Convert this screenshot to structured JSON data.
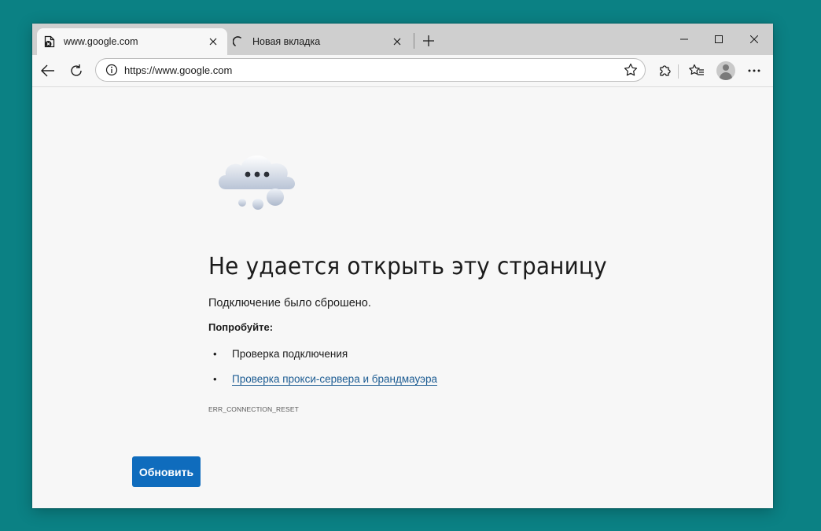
{
  "tabs": [
    {
      "title": "www.google.com",
      "active": true,
      "icon": "error-page-icon"
    },
    {
      "title": "Новая вкладка",
      "active": false,
      "icon": "loading-spinner-icon"
    }
  ],
  "address_bar": {
    "url": "https://www.google.com"
  },
  "error_page": {
    "title": "Не удается открыть эту страницу",
    "subtitle": "Подключение было сброшено.",
    "try_label": "Попробуйте:",
    "suggestions": [
      "Проверка подключения",
      "Проверка прокси-сервера и брандмауэра"
    ],
    "error_code": "ERR_CONNECTION_RESET",
    "refresh_label": "Обновить"
  },
  "colors": {
    "accent": "#0f6cbd",
    "link": "#1b5b92",
    "desktop": "#0b8184"
  }
}
